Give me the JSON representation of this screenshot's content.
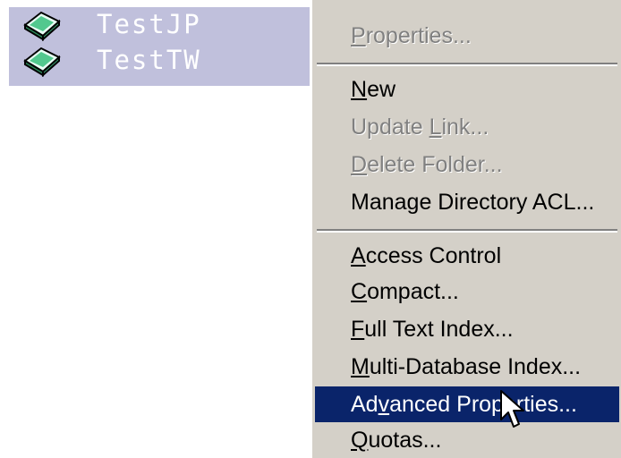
{
  "tree": {
    "items": [
      {
        "label": "TestJP",
        "icon": "database-book-icon"
      },
      {
        "label": "TestTW",
        "icon": "database-book-icon"
      }
    ],
    "selection_color": "#c0c0dc"
  },
  "menu": {
    "highlight_color": "#0a246a",
    "disabled_color": "#808080",
    "items": [
      {
        "pre": "",
        "mn": "P",
        "post": "roperties...",
        "enabled": false
      },
      {
        "pre": "",
        "mn": "N",
        "post": "ew",
        "enabled": true
      },
      {
        "pre": "Update ",
        "mn": "L",
        "post": "ink...",
        "enabled": false
      },
      {
        "pre": "",
        "mn": "D",
        "post": "elete Folder...",
        "enabled": false
      },
      {
        "pre": "Mana",
        "mn": "g",
        "post": "e Directory ACL...",
        "enabled": true
      },
      {
        "pre": "",
        "mn": "A",
        "post": "ccess Control",
        "enabled": true
      },
      {
        "pre": "",
        "mn": "C",
        "post": "ompact...",
        "enabled": true
      },
      {
        "pre": "",
        "mn": "F",
        "post": "ull Text Index...",
        "enabled": true
      },
      {
        "pre": "",
        "mn": "M",
        "post": "ulti-Database Index...",
        "enabled": true
      },
      {
        "pre": "Ad",
        "mn": "v",
        "post": "anced Properties...",
        "enabled": true,
        "selected": true
      },
      {
        "pre": "",
        "mn": "Q",
        "post": "uotas...",
        "enabled": true
      }
    ]
  },
  "cursor": {
    "icon": "arrow-cursor-icon"
  }
}
